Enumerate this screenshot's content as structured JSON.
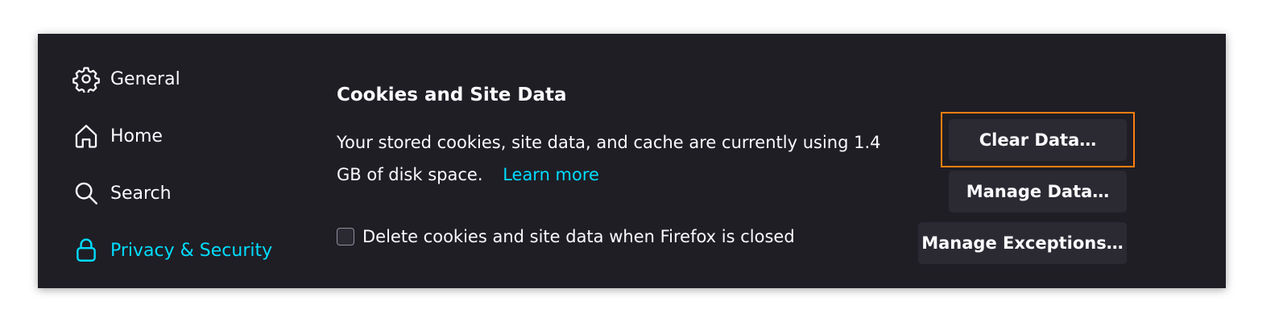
{
  "sidebar": {
    "items": [
      {
        "label": "General",
        "icon": "gear-icon"
      },
      {
        "label": "Home",
        "icon": "home-icon"
      },
      {
        "label": "Search",
        "icon": "search-icon"
      },
      {
        "label": "Privacy & Security",
        "icon": "lock-icon",
        "active": true
      }
    ]
  },
  "cookies": {
    "title": "Cookies and Site Data",
    "description": "Your stored cookies, site data, and cache are currently using 1.4 GB of disk space.",
    "learn_more": "Learn more",
    "checkbox_label": "Delete cookies and site data when Firefox is closed",
    "checkbox_checked": false
  },
  "buttons": {
    "clear_data": "Clear Data…",
    "manage_data": "Manage Data…",
    "manage_exceptions": "Manage Exceptions…"
  },
  "colors": {
    "background": "#1f1e25",
    "accent": "#00ddff",
    "button_bg": "#2b2a33",
    "highlight": "#ff7e0f"
  }
}
